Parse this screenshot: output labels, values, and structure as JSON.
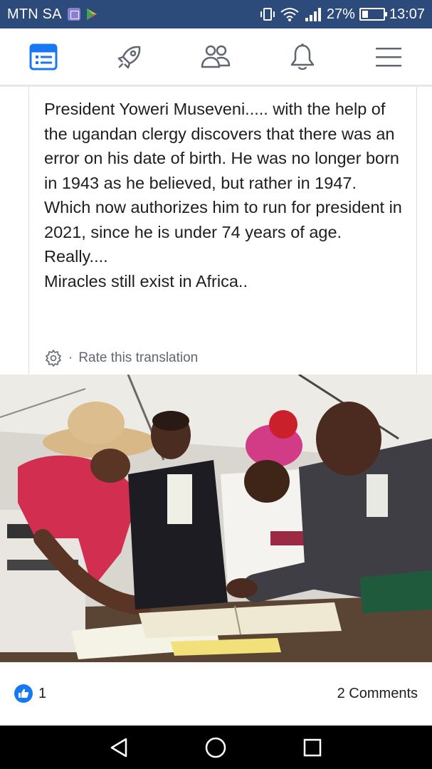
{
  "status_bar": {
    "carrier": "MTN SA",
    "battery_percent": "27%",
    "time": "13:07",
    "icons": [
      "notification-box-icon",
      "play-store-icon",
      "vibrate-icon",
      "wifi-icon",
      "signal-icon",
      "battery-icon"
    ]
  },
  "top_nav": {
    "items": [
      "news-feed-icon",
      "rocket-icon",
      "friends-icon",
      "notifications-bell-icon",
      "menu-icon"
    ],
    "active": "news-feed-icon",
    "accent_color": "#1877f2"
  },
  "post": {
    "lines": [
      "President Yoweri Museveni..... with the help of the ugandan clergy discovers that there was an error on his date of birth. He was no longer born in 1943 as he believed, but rather in 1947.",
      "Which now authorizes him to run for president in 2021, since he is under 74 years of age.",
      "Really....",
      "Miracles still exist in Africa.."
    ],
    "translation_separator": "·",
    "translation_link": "Rate this translation"
  },
  "reactions": {
    "like_count": "1",
    "comments": "2 Comments"
  },
  "android_nav": {
    "items": [
      "back-icon",
      "home-icon",
      "recents-icon"
    ]
  }
}
